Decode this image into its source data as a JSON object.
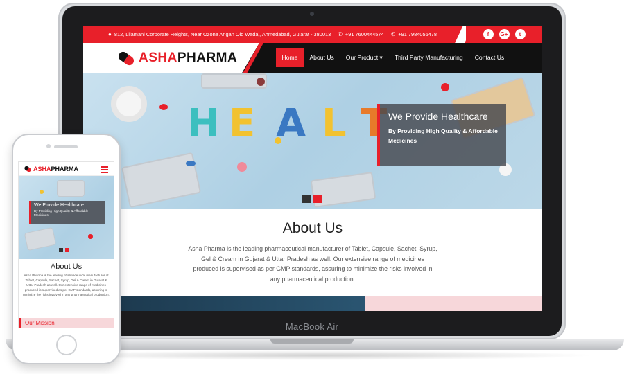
{
  "laptop": {
    "model_label": "MacBook Air"
  },
  "site": {
    "brand_part1": "ASHA",
    "brand_part2": "PHARMA",
    "topbar": {
      "address": "812, Lilamani Corporate Heights, Near Ozone Angan Old Wadaj, Ahmedabad, Gujarat - 380013",
      "phone1": "+91 7600444574",
      "phone2": "+91 7984056478",
      "social": [
        "f",
        "G+",
        "t"
      ]
    },
    "nav": [
      {
        "label": "Home",
        "active": true
      },
      {
        "label": "About Us",
        "active": false
      },
      {
        "label": "Our Product ▾",
        "active": false
      },
      {
        "label": "Third Party Manufacturing",
        "active": false
      },
      {
        "label": "Contact Us",
        "active": false
      }
    ],
    "hero": {
      "word": [
        "H",
        "E",
        "A",
        "L",
        "T"
      ],
      "title": "We Provide Healthcare",
      "subtitle": "By Providing High Quality & Affordable Medicines"
    },
    "about": {
      "heading": "About Us",
      "body": "Asha Pharma is the leading pharmaceutical manufacturer of Tablet, Capsule, Sachet, Syrup, Gel & Cream in Gujarat & Uttar Pradesh as well. Our extensive range of medicines produced is supervised as per GMP standards, assuring to minimize the risks involved in any pharmaceutical production."
    },
    "mission_label": "Our Mission"
  },
  "colors": {
    "accent": "#e8202a",
    "dark": "#111111",
    "hero_bg": "#b9d7e8"
  }
}
